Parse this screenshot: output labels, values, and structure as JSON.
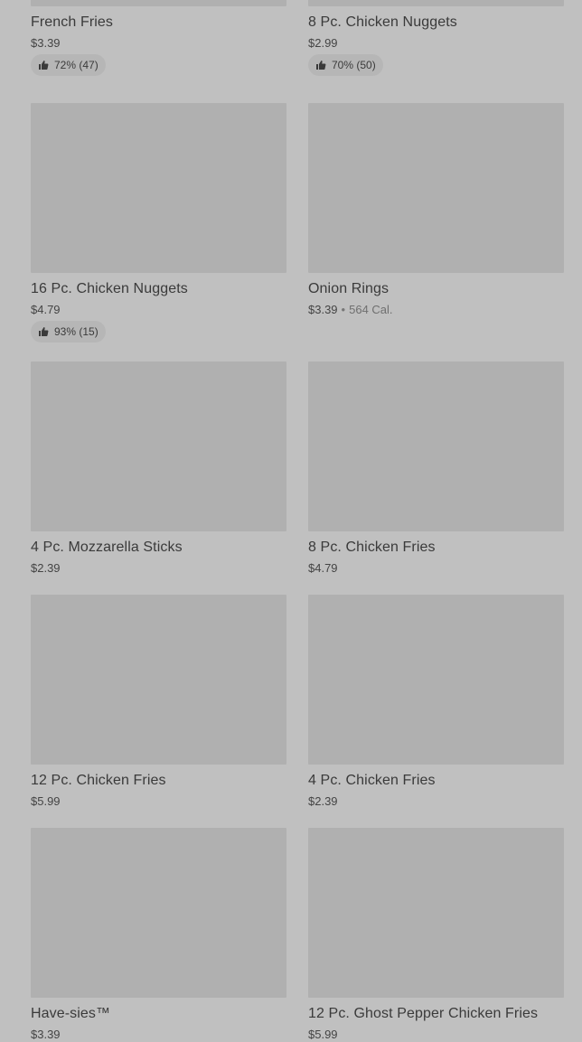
{
  "menu_items": [
    {
      "name": "French Fries",
      "price": "$3.39",
      "rating": "72% (47)"
    },
    {
      "name": "8 Pc. Chicken Nuggets",
      "price": "$2.99",
      "rating": "70% (50)"
    },
    {
      "name": "16 Pc. Chicken Nuggets",
      "price": "$4.79",
      "rating": "93% (15)"
    },
    {
      "name": "Onion Rings",
      "price": "$3.39",
      "separator": "•",
      "calories": "564 Cal."
    },
    {
      "name": "4 Pc. Mozzarella Sticks",
      "price": "$2.39"
    },
    {
      "name": "8 Pc. Chicken Fries",
      "price": "$4.79"
    },
    {
      "name": "12 Pc. Chicken Fries",
      "price": "$5.99"
    },
    {
      "name": "4 Pc. Chicken Fries",
      "price": "$2.39"
    },
    {
      "name": "Have-sies™",
      "price": "$3.39"
    },
    {
      "name": "12 Pc. Ghost Pepper Chicken Fries",
      "price": "$5.99"
    }
  ],
  "icons": {
    "rating_icon": "thumbs-up-icon"
  },
  "colors": {
    "background": "#c0c0c0",
    "image_placeholder": "#b0b0b0",
    "rating_pill": "#b6b6b6",
    "text": "#3a3a3a"
  }
}
